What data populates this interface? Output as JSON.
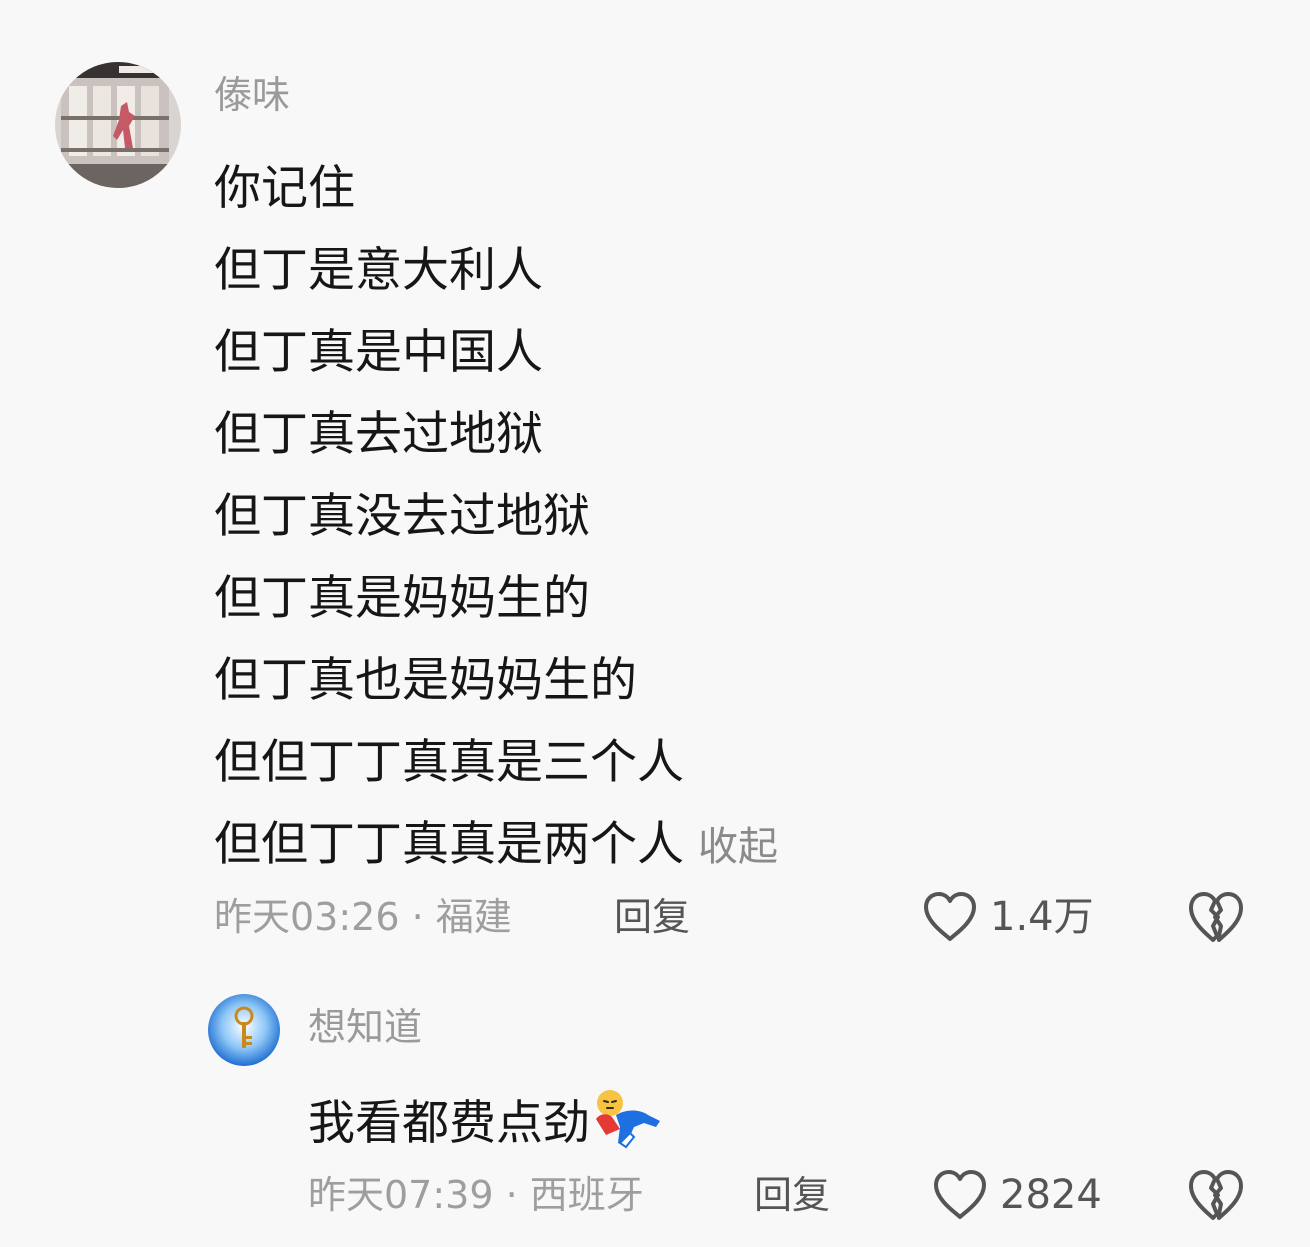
{
  "comments": [
    {
      "username": "傣味",
      "content_lines": [
        "你记住",
        "但丁是意大利人",
        "但丁真是中国人",
        "但丁真去过地狱",
        "但丁真没去过地狱",
        "但丁真是妈妈生的",
        "但丁真也是妈妈生的",
        "但但丁丁真真是三个人",
        "但但丁丁真真是两个人"
      ],
      "collapse_label": "收起",
      "meta": "昨天03:26 · 福建",
      "reply_label": "回复",
      "like_count": "1.4万",
      "like_icon": "heart-outline-icon",
      "dislike_icon": "broken-heart-icon"
    },
    {
      "username": "想知道",
      "content": "我看都费点劲",
      "emoji_icon": "lying-down-emoji",
      "meta": "昨天07:39 · 西班牙",
      "reply_label": "回复",
      "like_count": "2824",
      "like_icon": "heart-outline-icon",
      "dislike_icon": "broken-heart-icon"
    }
  ],
  "colors": {
    "background": "#f8f8f8",
    "text": "#161616",
    "muted": "#9a9a9a",
    "action": "#555555"
  }
}
